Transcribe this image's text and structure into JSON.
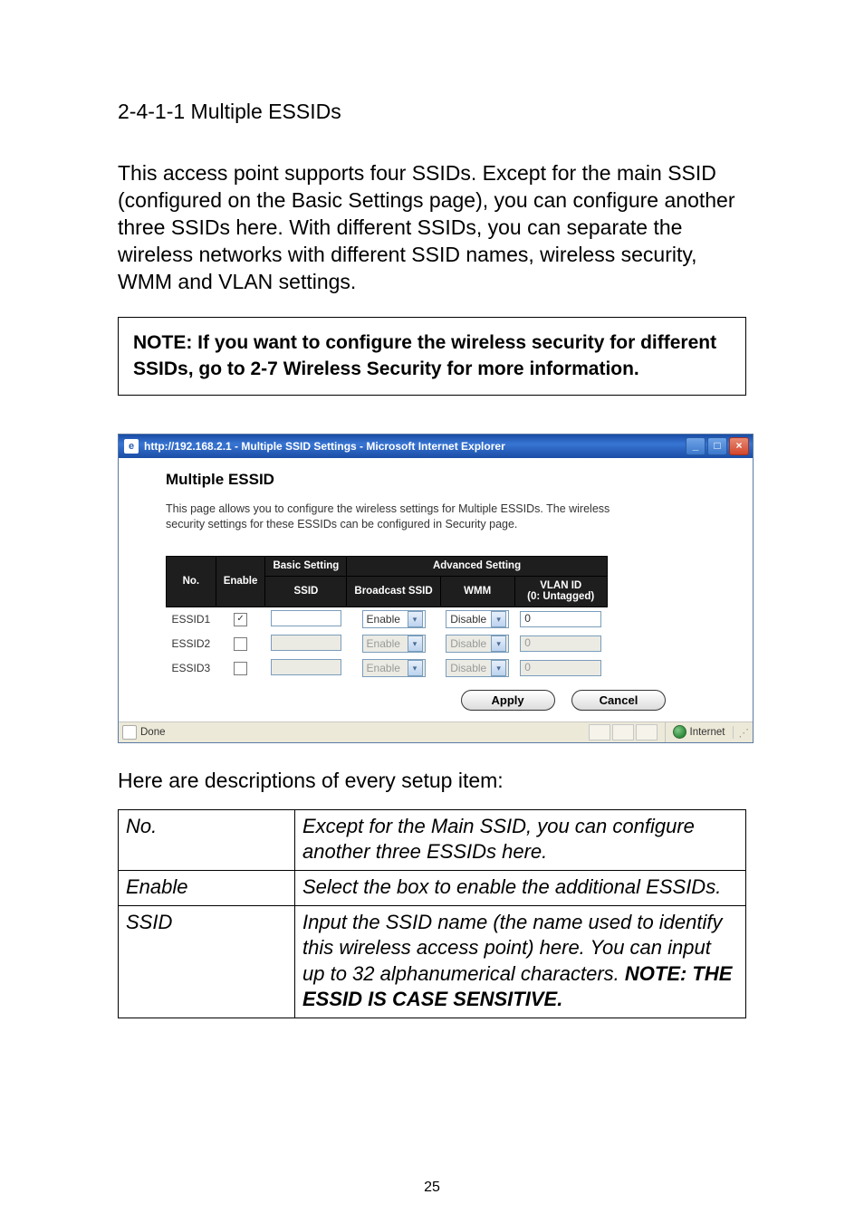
{
  "heading": "2-4-1-1 Multiple ESSIDs",
  "intro_para": "This access point supports four SSIDs. Except for the main SSID (configured on the Basic Settings page), you can configure another three SSIDs here. With different SSIDs, you can separate the wireless networks with different SSID names, wireless security, WMM and VLAN settings.",
  "note_text": "NOTE: If you want to configure the wireless security for different SSIDs, go to 2-7 Wireless Security for more information.",
  "browser": {
    "title": "http://192.168.2.1 - Multiple SSID Settings - Microsoft Internet Explorer",
    "status_done": "Done",
    "status_zone": "Internet"
  },
  "pane": {
    "title": "Multiple ESSID",
    "desc": "This page allows you to configure the wireless settings for Multiple ESSIDs. The wireless security settings for these ESSIDs can be configured in Security page.",
    "headers": {
      "no": "No.",
      "enable": "Enable",
      "basic": "Basic Setting",
      "advanced": "Advanced Setting",
      "ssid": "SSID",
      "broadcast": "Broadcast SSID",
      "wmm": "WMM",
      "vlan": "VLAN ID\n(0: Untagged)"
    },
    "rows": [
      {
        "no": "ESSID1",
        "enabled": true,
        "ssid": "",
        "broadcast": "Enable",
        "wmm": "Disable",
        "vlan": "0",
        "active": true
      },
      {
        "no": "ESSID2",
        "enabled": false,
        "ssid": "",
        "broadcast": "Enable",
        "wmm": "Disable",
        "vlan": "0",
        "active": false
      },
      {
        "no": "ESSID3",
        "enabled": false,
        "ssid": "",
        "broadcast": "Enable",
        "wmm": "Disable",
        "vlan": "0",
        "active": false
      }
    ],
    "apply": "Apply",
    "cancel": "Cancel"
  },
  "desc_heading": "Here are descriptions of every setup item:",
  "def_table": [
    {
      "key": "No.",
      "val": "Except for the Main SSID, you can configure another three ESSIDs here."
    },
    {
      "key": "Enable",
      "val": "Select the box to enable the additional ESSIDs."
    },
    {
      "key": "SSID",
      "val": "Input the SSID name (the name used to identify this wireless access point) here. You can input up to 32 alphanumerical characters. ",
      "val_bold": "NOTE: THE ESSID IS CASE SENSITIVE."
    }
  ],
  "page_number": "25"
}
